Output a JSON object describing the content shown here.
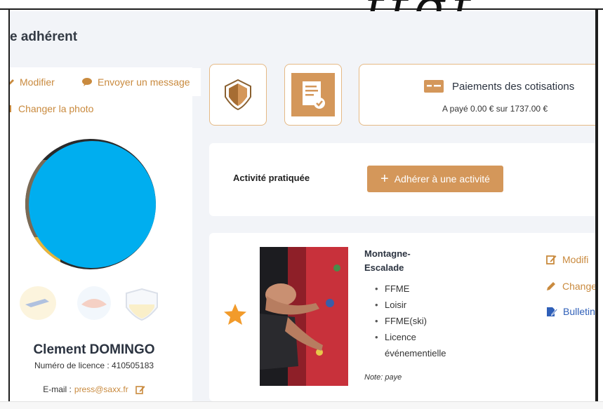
{
  "header": {
    "title": "e adhérent"
  },
  "profile": {
    "actions": {
      "edit": "Modifier",
      "message": "Envoyer un message",
      "photo": "Changer la photo"
    },
    "name": "Clement DOMINGO",
    "licence": "Numéro de licence : 410505183",
    "email_label": "E-mail :",
    "email": "press@saxx.fr"
  },
  "payment": {
    "title": "Paiements des cotisations",
    "summary": "A payé 0.00 € sur 1737.00 €"
  },
  "activity": {
    "label": "Activité pratiquée",
    "join_button": "Adhérer à une activité"
  },
  "membership": {
    "sport": "Montagne-Escalade",
    "tags": [
      "FFME",
      "Loisir",
      "FFME(ski)",
      "Licence événementielle"
    ],
    "note": "Note: paye",
    "actions": {
      "edit": "Modifi",
      "change": "Change",
      "bulletin": "Bulletin"
    }
  },
  "colors": {
    "accent": "#c98a3e",
    "button": "#d4975a",
    "link_blue": "#2f5fb8",
    "star": "#f29b2b",
    "avatar": "#00aeef"
  }
}
